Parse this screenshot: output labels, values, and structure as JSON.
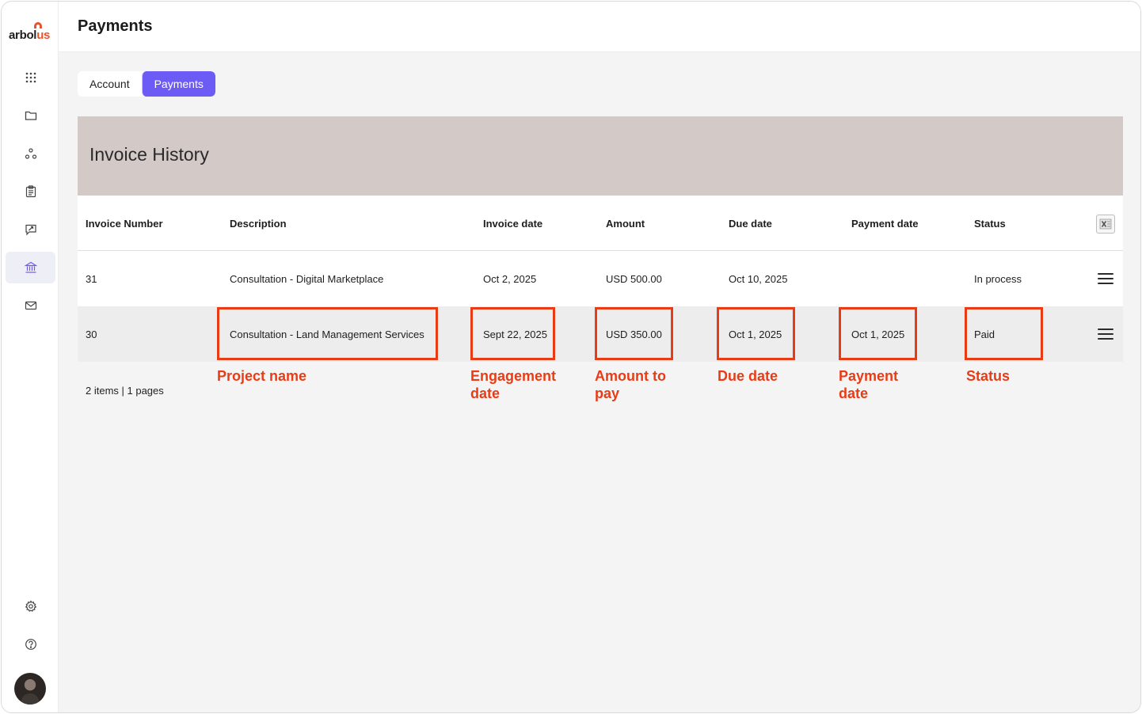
{
  "brand": {
    "logo_text_main": "arbol",
    "logo_text_accent": "us",
    "accent_color": "#e8532e"
  },
  "sidebar": {
    "items": [
      {
        "name": "dashboard",
        "icon": "grid-icon"
      },
      {
        "name": "projects",
        "icon": "folder-icon"
      },
      {
        "name": "network",
        "icon": "network-icon"
      },
      {
        "name": "documents",
        "icon": "clipboard-icon"
      },
      {
        "name": "messages",
        "icon": "chat-icon"
      },
      {
        "name": "payments",
        "icon": "bank-icon",
        "active": true
      },
      {
        "name": "inbox",
        "icon": "mail-icon"
      },
      {
        "name": "settings",
        "icon": "gear-icon"
      },
      {
        "name": "help",
        "icon": "help-icon"
      }
    ],
    "active_color": "#6c5cf5"
  },
  "header": {
    "title": "Payments"
  },
  "tabs": [
    {
      "label": "Account",
      "active": false
    },
    {
      "label": "Payments",
      "active": true
    }
  ],
  "card": {
    "title": "Invoice History",
    "header_color": "#d3c9c7"
  },
  "table": {
    "columns": [
      "Invoice Number",
      "Description",
      "Invoice date",
      "Amount",
      "Due date",
      "Payment date",
      "Status"
    ],
    "rows": [
      {
        "invoice_number": "31",
        "description": "Consultation - Digital Marketplace",
        "invoice_date": "Oct 2, 2025",
        "amount": "USD 500.00",
        "due_date": "Oct 10, 2025",
        "payment_date": "",
        "status": "In process"
      },
      {
        "invoice_number": "30",
        "description": "Consultation - Land Management Services",
        "invoice_date": "Sept 22, 2025",
        "amount": "USD 350.00",
        "due_date": "Oct 1, 2025",
        "payment_date": "Oct 1, 2025",
        "status": "Paid"
      }
    ],
    "footer": "2 items | 1 pages"
  },
  "annotations": {
    "color": "#e83c16",
    "labels": {
      "project_name": "Project name",
      "engagement_date_1": "Engagement",
      "engagement_date_2": "date",
      "amount_1": "Amount to",
      "amount_2": "pay",
      "due_date": "Due date",
      "payment_date_1": "Payment",
      "payment_date_2": "date",
      "status": "Status"
    }
  }
}
